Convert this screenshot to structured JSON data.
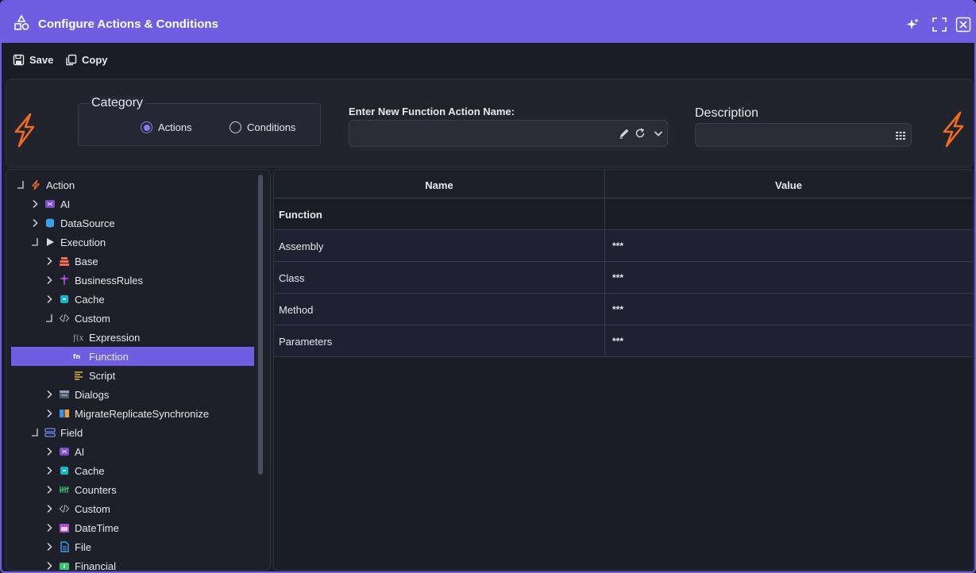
{
  "window": {
    "title": "Configure Actions & Conditions"
  },
  "toolbar": {
    "save_label": "Save",
    "copy_label": "Copy"
  },
  "header": {
    "category_legend": "Category",
    "radio_actions": "Actions",
    "radio_conditions": "Conditions",
    "selected_category": "Actions",
    "function_name_label": "Enter New Function Action Name:",
    "function_name_value": "",
    "description_label": "Description",
    "description_value": ""
  },
  "tree": [
    {
      "label": "Action",
      "icon": "bolt-icon",
      "expanded": true
    },
    {
      "label": "AI",
      "icon": "ai-icon",
      "expanded": false
    },
    {
      "label": "DataSource",
      "icon": "database-icon",
      "expanded": false
    },
    {
      "label": "Execution",
      "icon": "play-icon",
      "expanded": true
    },
    {
      "label": "Base",
      "icon": "stack-icon",
      "expanded": false
    },
    {
      "label": "BusinessRules",
      "icon": "rules-icon",
      "expanded": false
    },
    {
      "label": "Cache",
      "icon": "cache-icon",
      "expanded": false
    },
    {
      "label": "Custom",
      "icon": "code-icon",
      "expanded": true
    },
    {
      "label": "Expression",
      "icon": "expression-icon"
    },
    {
      "label": "Function",
      "icon": "function-icon",
      "selected": true
    },
    {
      "label": "Script",
      "icon": "script-icon"
    },
    {
      "label": "Dialogs",
      "icon": "dialog-icon",
      "expanded": false
    },
    {
      "label": "MigrateReplicateSynchronize",
      "icon": "sync-icon",
      "expanded": false
    },
    {
      "label": "Field",
      "icon": "field-icon",
      "expanded": true
    },
    {
      "label": "AI",
      "icon": "ai-icon",
      "expanded": false
    },
    {
      "label": "Cache",
      "icon": "cache-icon",
      "expanded": false
    },
    {
      "label": "Counters",
      "icon": "counter-icon",
      "expanded": false
    },
    {
      "label": "Custom",
      "icon": "code-icon",
      "expanded": false
    },
    {
      "label": "DateTime",
      "icon": "calendar-icon",
      "expanded": false
    },
    {
      "label": "File",
      "icon": "file-icon",
      "expanded": false
    },
    {
      "label": "Financial",
      "icon": "financial-icon",
      "expanded": false
    }
  ],
  "grid": {
    "columns": [
      "Name",
      "Value"
    ],
    "group": "Function",
    "rows": [
      {
        "name": "Assembly",
        "value": "***"
      },
      {
        "name": "Class",
        "value": "***"
      },
      {
        "name": "Method",
        "value": "***"
      },
      {
        "name": "Parameters",
        "value": "***"
      }
    ]
  },
  "colors": {
    "accent": "#6f5de2",
    "bolt": "#f26b21",
    "background": "#1b1d26"
  }
}
